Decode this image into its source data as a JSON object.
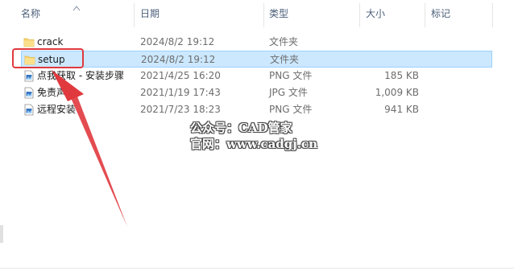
{
  "columns": {
    "name": "名称",
    "date": "日期",
    "type": "类型",
    "size": "大小",
    "tags": "标记"
  },
  "files": [
    {
      "name": "crack",
      "date": "2024/8/2 19:12",
      "type": "文件夹",
      "size": "",
      "icon": "folder-icon",
      "selected": false
    },
    {
      "name": "setup",
      "date": "2024/8/2 19:12",
      "type": "文件夹",
      "size": "",
      "icon": "folder-icon",
      "selected": true
    },
    {
      "name": "点我获取 - 安装步骤",
      "date": "2021/4/25 16:20",
      "type": "PNG 文件",
      "size": "185 KB",
      "icon": "image-file-icon",
      "selected": false
    },
    {
      "name": "免责声明",
      "date": "2021/1/19 17:43",
      "type": "JPG 文件",
      "size": "1,009 KB",
      "icon": "image-file-icon",
      "selected": false
    },
    {
      "name": "远程安装",
      "date": "2021/7/23 18:23",
      "type": "PNG 文件",
      "size": "941 KB",
      "icon": "image-file-icon",
      "selected": false
    }
  ],
  "watermark": {
    "line1": "公众号：CAD管家",
    "line2": "官网：www.cadgj.cn"
  },
  "colors": {
    "selection": "#cce8ff",
    "annotation_red": "#e0393e",
    "folder_yellow": "#f8d775"
  }
}
